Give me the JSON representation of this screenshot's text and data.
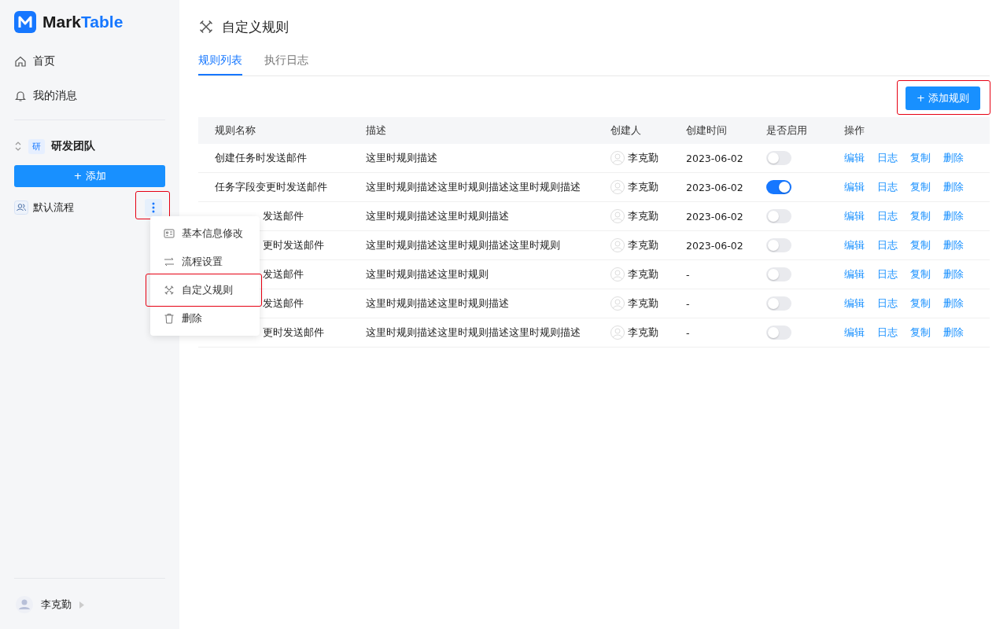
{
  "logo": {
    "name_dark": "Mark",
    "name_accent": "Table"
  },
  "nav": [
    {
      "label": "首页",
      "kind": "home"
    },
    {
      "label": "我的消息",
      "kind": "bell"
    }
  ],
  "team": {
    "badge": "研",
    "name": "研发团队",
    "add_button": "+ 添加"
  },
  "flows": [
    {
      "label": "默认流程",
      "more_highlighted": true
    }
  ],
  "context_menu": [
    {
      "label": "基本信息修改",
      "kind": "card",
      "highlighted": false
    },
    {
      "label": "流程设置",
      "kind": "swap",
      "highlighted": false
    },
    {
      "label": "自定义规则",
      "kind": "tools",
      "highlighted": true
    },
    {
      "label": "删除",
      "kind": "trash",
      "highlighted": false
    }
  ],
  "user": {
    "name": "李克勤"
  },
  "page_title": "自定义规则",
  "tabs": [
    {
      "label": "规则列表",
      "selected": true
    },
    {
      "label": "执行日志",
      "selected": false
    }
  ],
  "add_rule_button": {
    "label": "+ 添加规则",
    "highlighted": true
  },
  "table": {
    "columns": [
      "规则名称",
      "描述",
      "创建人",
      "创建时间",
      "是否启用",
      "操作"
    ],
    "rows": [
      {
        "name": "创建任务时发送邮件",
        "clipped": false,
        "description": "这里时规则描述",
        "creator": "李克勤",
        "created": "2023-06-02",
        "enabled": false,
        "actions": [
          "编辑",
          "日志",
          "复制",
          "删除"
        ]
      },
      {
        "name": "任务字段变更时发送邮件",
        "clipped": false,
        "description": "这里时规则描述这里时规则描述这里时规则描述",
        "creator": "李克勤",
        "created": "2023-06-02",
        "enabled": true,
        "actions": [
          "编辑",
          "日志",
          "复制",
          "删除"
        ]
      },
      {
        "name": "发送邮件",
        "clipped": true,
        "description": "这里时规则描述这里时规则描述",
        "creator": "李克勤",
        "created": "2023-06-02",
        "enabled": false,
        "actions": [
          "编辑",
          "日志",
          "复制",
          "删除"
        ]
      },
      {
        "name": "更时发送邮件",
        "clipped": true,
        "description": "这里时规则描述这里时规则描述这里时规则",
        "creator": "李克勤",
        "created": "2023-06-02",
        "enabled": false,
        "actions": [
          "编辑",
          "日志",
          "复制",
          "删除"
        ]
      },
      {
        "name": "发送邮件",
        "clipped": true,
        "description": "这里时规则描述这里时规则",
        "creator": "李克勤",
        "created": "-",
        "enabled": false,
        "actions": [
          "编辑",
          "日志",
          "复制",
          "删除"
        ]
      },
      {
        "name": "发送邮件",
        "clipped": true,
        "description": "这里时规则描述这里时规则描述",
        "creator": "李克勤",
        "created": "-",
        "enabled": false,
        "actions": [
          "编辑",
          "日志",
          "复制",
          "删除"
        ]
      },
      {
        "name": "更时发送邮件",
        "clipped": true,
        "description": "这里时规则描述这里时规则描述这里时规则描述",
        "creator": "李克勤",
        "created": "-",
        "enabled": false,
        "actions": [
          "编辑",
          "日志",
          "复制",
          "删除"
        ]
      }
    ]
  }
}
